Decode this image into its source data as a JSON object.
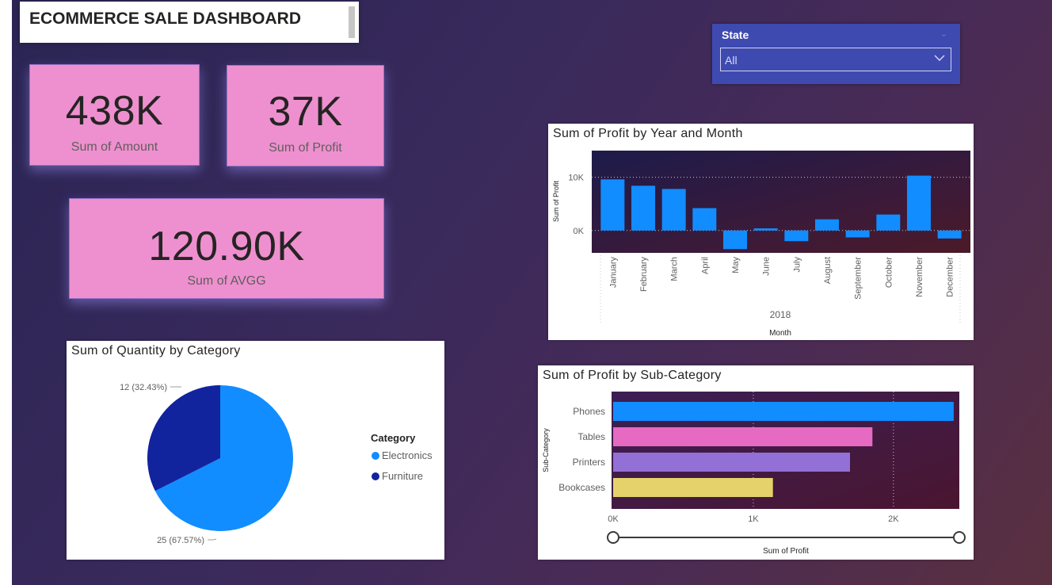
{
  "dashboard": {
    "title": "ECOMMERCE SALE DASHBOARD"
  },
  "kpis": [
    {
      "value": "438K",
      "label": "Sum of Amount"
    },
    {
      "value": "37K",
      "label": "Sum of Profit"
    },
    {
      "value": "120.90K",
      "label": "Sum of AVGG"
    }
  ],
  "slicer": {
    "title": "State",
    "selected": "All"
  },
  "colors": {
    "bar_blue": "#118dff",
    "kpi_pink": "#ee90cf",
    "electronics": "#118dff",
    "furniture": "#12239e",
    "phones": "#118dff",
    "tables": "#e66ac1",
    "printers": "#9370d6",
    "bookcases": "#e6d26a"
  },
  "chart_data": [
    {
      "type": "bar",
      "title": "Sum of Profit by Year and Month",
      "xlabel": "Month",
      "x_group_label": "2018",
      "ylabel": "Sum of Profit",
      "y_ticks": [
        "10K",
        "0K"
      ],
      "ylim": [
        -4200,
        15000
      ],
      "categories": [
        "January",
        "February",
        "March",
        "April",
        "May",
        "June",
        "July",
        "August",
        "September",
        "October",
        "November",
        "December"
      ],
      "values": [
        9600,
        8400,
        7800,
        4200,
        -3500,
        400,
        -2000,
        2100,
        -1300,
        3000,
        10300,
        -1500
      ]
    },
    {
      "type": "pie",
      "title": "Sum of Quantity by Category",
      "legend_title": "Category",
      "legend_position": "right",
      "slices": [
        {
          "name": "Electronics",
          "value": 25,
          "label": "25 (67.57%)"
        },
        {
          "name": "Furniture",
          "value": 12,
          "label": "12 (32.43%)"
        }
      ]
    },
    {
      "type": "bar",
      "orientation": "horizontal",
      "title": "Sum of Profit by Sub-Category",
      "xlabel": "Sum of Profit",
      "ylabel": "Sub-Category",
      "x_ticks": [
        "0K",
        "1K",
        "2K"
      ],
      "xlim": [
        0,
        2470
      ],
      "categories": [
        "Phones",
        "Tables",
        "Printers",
        "Bookcases"
      ],
      "values": [
        2430,
        1850,
        1690,
        1140
      ]
    }
  ]
}
